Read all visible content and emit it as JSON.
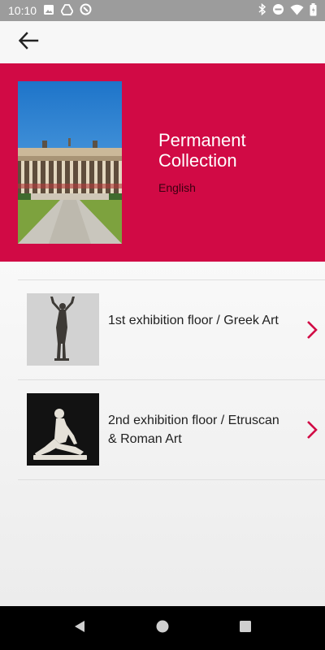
{
  "colors": {
    "accent": "#d10a45",
    "text_dark": "#222222"
  },
  "status_bar": {
    "time": "10:10",
    "left_icons": [
      "image-icon",
      "drive-icon",
      "block-icon"
    ],
    "right_icons": [
      "bluetooth-icon",
      "dnd-icon",
      "wifi-icon",
      "battery-icon"
    ]
  },
  "app_bar": {
    "back_icon": "arrow-left-icon"
  },
  "hero": {
    "title": "Permanent Collection",
    "language": "English"
  },
  "list": {
    "items": [
      {
        "title": "1st exhibition floor / Greek Art",
        "icon": "chevron-right-icon"
      },
      {
        "title": "2nd exhibition floor / Etruscan & Roman Art",
        "icon": "chevron-right-icon"
      }
    ]
  },
  "nav": {
    "buttons": [
      "back-triangle-icon",
      "home-circle-icon",
      "recents-square-icon"
    ]
  }
}
